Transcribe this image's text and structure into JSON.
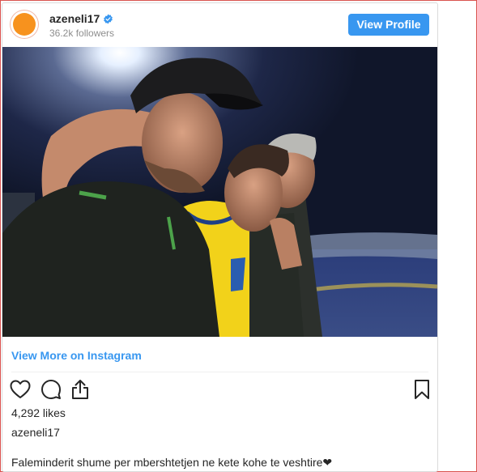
{
  "header": {
    "username": "azeneli17",
    "followers": "36.2k followers",
    "view_profile_label": "View Profile"
  },
  "post": {
    "view_more_label": "View More on Instagram",
    "likes": "4,292 likes",
    "owner": "azeneli17",
    "caption": "Faleminderit shume per mbershtetjen ne kete kohe te veshtire❤"
  },
  "colors": {
    "accent": "#3897f0",
    "avatar": "#f7921e",
    "text": "#262626",
    "muted": "#8e8e8e"
  },
  "icons": [
    "verified-badge-icon",
    "heart-icon",
    "comment-icon",
    "share-icon",
    "bookmark-icon"
  ]
}
